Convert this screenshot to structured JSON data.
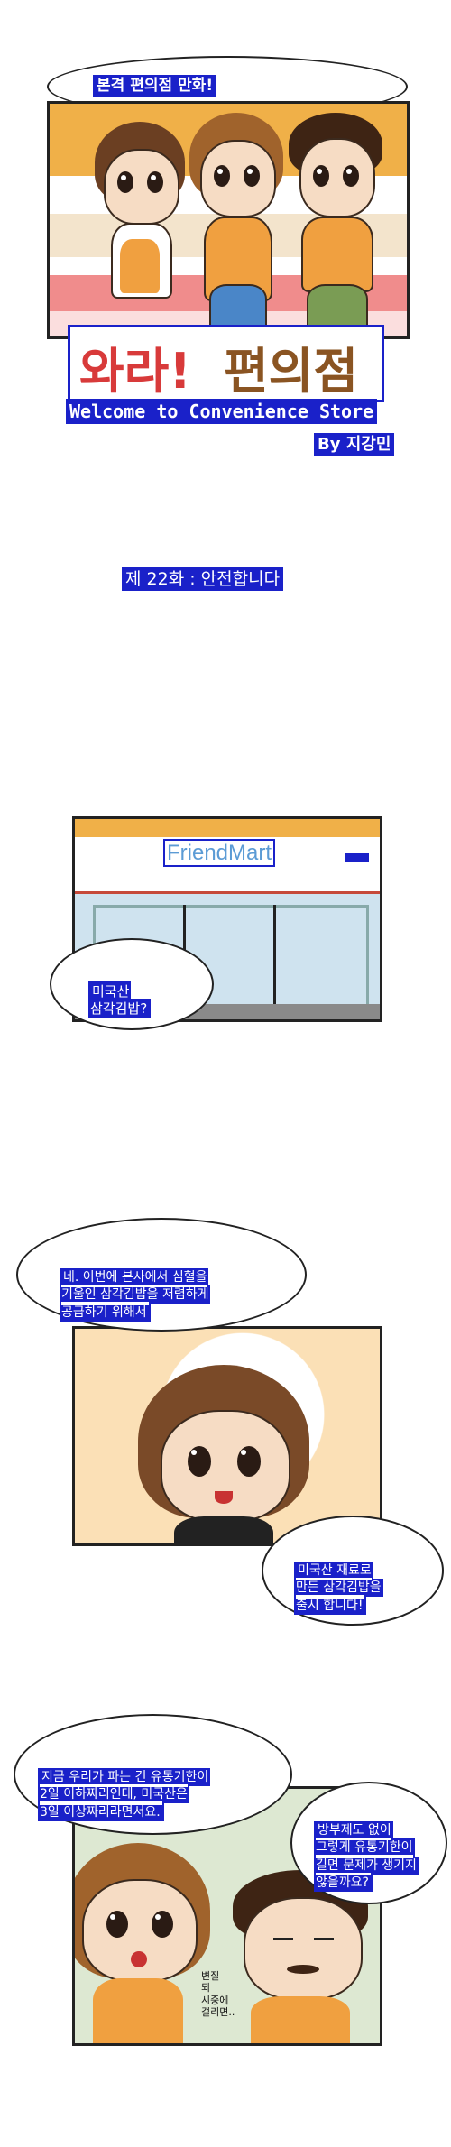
{
  "cover": {
    "tagline": "본격 편의점 만화!",
    "logo_kr_1": "와라!",
    "logo_kr_2": "편의점",
    "subtitle": "Welcome to Convenience Store",
    "author": "By 지강민"
  },
  "episode": {
    "title": "제 22화 : 안전합니다"
  },
  "panel1": {
    "store_sign": "FriendMart",
    "small_sign": "",
    "bubble": "미국산\n삼각김밥?"
  },
  "panel2": {
    "bubble_top": "네. 이번에 본사에서 심혈을\n기울인 삼각김밥을 저렴하게\n공급하기 위해서",
    "bubble_bottom": "미국산 재료로\n만든 삼각김밥을\n출시 합니다!"
  },
  "panel3": {
    "bubble_left": "지금 우리가 파는 건 유통기한이\n2일 이하짜리인데, 미국산은\n3일 이상짜리라면서요.",
    "bubble_right": "방부제도 없이\n그렇게 유통기한이\n길면 문제가 생기지\n않을까요?",
    "small_text": "변질\n되\n시중에\n걸리면.."
  },
  "colors": {
    "highlight": "#1a21c9",
    "cover_orange": "#f0b048",
    "cover_pink": "#f08c8c",
    "logo_red": "#d83a3a",
    "logo_brown": "#8a5422",
    "apron": "#f0a040"
  }
}
